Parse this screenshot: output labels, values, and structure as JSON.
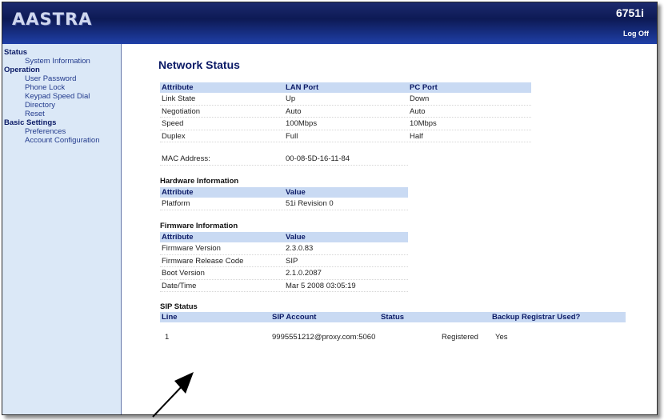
{
  "header": {
    "logo": "AASTRA",
    "model": "6751i",
    "logoff": "Log Off"
  },
  "sidebar": {
    "sections": [
      {
        "title": "Status",
        "items": [
          "System Information"
        ]
      },
      {
        "title": "Operation",
        "items": [
          "User Password",
          "Phone Lock",
          "Keypad Speed Dial",
          "Directory",
          "Reset"
        ]
      },
      {
        "title": "Basic Settings",
        "items": [
          "Preferences",
          "Account Configuration"
        ]
      }
    ]
  },
  "main": {
    "title": "Network Status",
    "network": {
      "headers": [
        "Attribute",
        "LAN Port",
        "PC Port"
      ],
      "rows": [
        [
          "Link State",
          "Up",
          "Down"
        ],
        [
          "Negotiation",
          "Auto",
          "Auto"
        ],
        [
          "Speed",
          "100Mbps",
          "10Mbps"
        ],
        [
          "Duplex",
          "Full",
          "Half"
        ]
      ],
      "mac_label": "MAC Address:",
      "mac_value": "00-08-5D-16-11-84"
    },
    "hardware": {
      "title": "Hardware Information",
      "headers": [
        "Attribute",
        "Value"
      ],
      "rows": [
        [
          "Platform",
          "51i Revision 0"
        ]
      ]
    },
    "firmware": {
      "title": "Firmware Information",
      "headers": [
        "Attribute",
        "Value"
      ],
      "rows": [
        [
          "Firmware Version",
          "2.3.0.83"
        ],
        [
          "Firmware Release Code",
          "SIP"
        ],
        [
          "Boot Version",
          "2.1.0.2087"
        ],
        [
          "Date/Time",
          "Mar 5 2008 03:05:19"
        ]
      ]
    },
    "sip": {
      "title": "SIP Status",
      "headers": [
        "Line",
        "SIP Account",
        "Status",
        "Backup Registrar Used?"
      ],
      "rows": [
        [
          "1",
          "9995551212@proxy.com:5060",
          "Registered",
          "Yes"
        ]
      ]
    }
  }
}
